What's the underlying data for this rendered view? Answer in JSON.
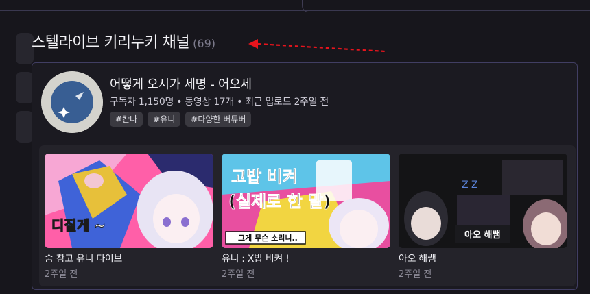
{
  "section": {
    "title": "스텔라이브 키리누키 채널",
    "count": "(69)"
  },
  "channel": {
    "name": "어떻게 오시가 세명 - 어오세",
    "meta": "구독자 1,150명 • 동영상 17개 • 최근 업로드 2주일 전",
    "tags": [
      "#칸나",
      "#유니",
      "#다양한 버튜버"
    ]
  },
  "videos": [
    {
      "title": "숨 참고 유니 다이브",
      "date": "2주일 전",
      "overlay": "디질게 ~"
    },
    {
      "title": "유니 : X밥 비켜 !",
      "date": "2주일 전",
      "overlay": "고밥 비켜\n(실제로 한 말)",
      "subtitle": "그게 무슨 소리니.."
    },
    {
      "title": "아오 해쌤",
      "date": "2주일 전",
      "overlay": "아오 해쌤"
    }
  ],
  "colors": {
    "background": "#17161c",
    "card_border": "#413e63",
    "arrow": "#e8141c"
  }
}
